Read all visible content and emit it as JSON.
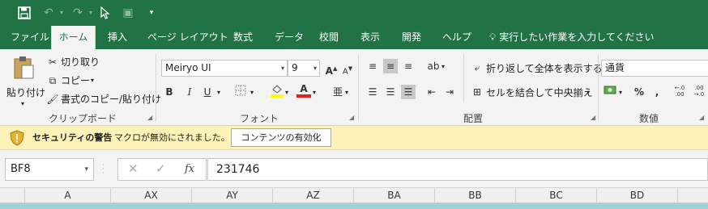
{
  "quick_access": {
    "icons": [
      "save-icon",
      "undo-icon",
      "redo-icon",
      "pointer-icon",
      "format-painter-icon",
      "customize-icon"
    ]
  },
  "tabs": [
    {
      "label": "ファイル"
    },
    {
      "label": "ホーム",
      "active": true
    },
    {
      "label": "挿入"
    },
    {
      "label": "ページ レイアウト"
    },
    {
      "label": "数式"
    },
    {
      "label": "データ"
    },
    {
      "label": "校閲"
    },
    {
      "label": "表示"
    },
    {
      "label": "開発"
    },
    {
      "label": "ヘルプ"
    }
  ],
  "tell_me": "実行したい作業を入力してください",
  "ribbon": {
    "clipboard": {
      "paste_label": "貼り付け",
      "cut_label": "切り取り",
      "copy_label": "コピー",
      "format_painter_label": "書式のコピー/貼り付け",
      "group_label": "クリップボード"
    },
    "font": {
      "font_name": "Meiryo UI",
      "font_size": "9",
      "bold": "B",
      "italic": "I",
      "underline": "U",
      "font_color_letter": "A",
      "grow_label": "A",
      "shrink_label": "A",
      "phonetic_label": "亜",
      "group_label": "フォント"
    },
    "alignment": {
      "wrap_text_label": "折り返して全体を表示する",
      "merge_center_label": "セルを結合して中央揃え",
      "group_label": "配置"
    },
    "number": {
      "format_value": "通貨",
      "percent": "%",
      "comma": ",",
      "increase_decimal": "←.0 .00",
      "decrease_decimal": ".00 →.0",
      "group_label": "数値"
    }
  },
  "security_bar": {
    "title": "セキュリティの警告",
    "message": "マクロが無効にされました。",
    "button_label": "コンテンツの有効化"
  },
  "formula_bar": {
    "name_box": "BF8",
    "fx": "fx",
    "value": "231746"
  },
  "columns": [
    "A",
    "AX",
    "AY",
    "AZ",
    "BA",
    "BB",
    "BC",
    "BD"
  ],
  "colors": {
    "accent": "#217346",
    "security_bg": "#fdf2b8",
    "font_color_bar": "#e3201b",
    "highlight_bar": "#ffff00",
    "row_fill": "#9fd1d6"
  }
}
